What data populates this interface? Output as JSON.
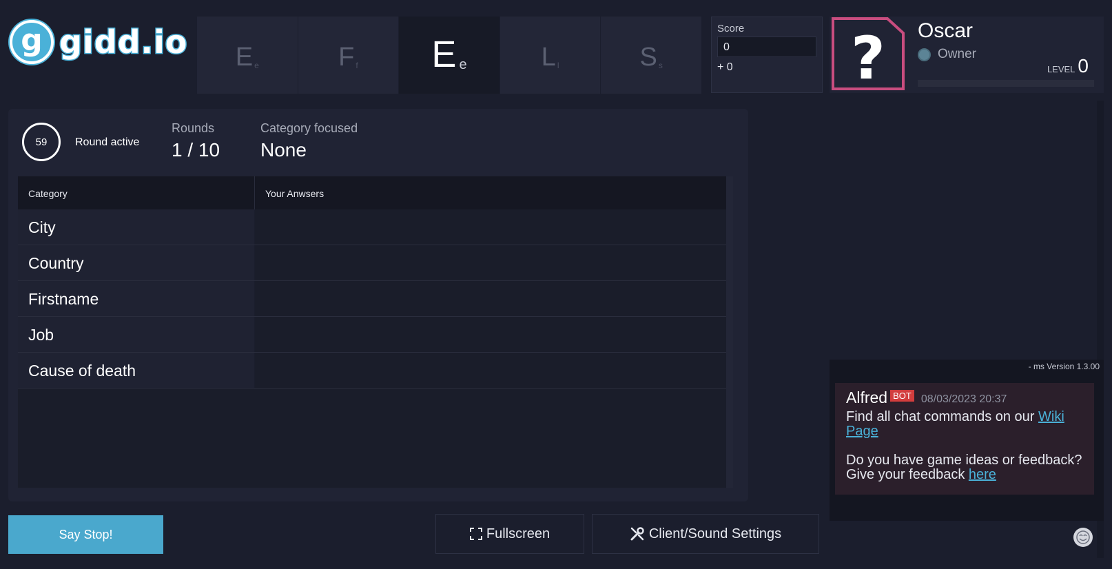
{
  "logo": {
    "mark": "g",
    "text": "gidd.io"
  },
  "letters": [
    {
      "big": "E",
      "small": "e",
      "active": false
    },
    {
      "big": "F",
      "small": "f",
      "active": false
    },
    {
      "big": "E",
      "small": "e",
      "active": true
    },
    {
      "big": "L",
      "small": "l",
      "active": false
    },
    {
      "big": "S",
      "small": "s",
      "active": false
    }
  ],
  "score": {
    "label": "Score",
    "value": "0",
    "plus": "+ 0"
  },
  "profile": {
    "name": "Oscar",
    "role": "Owner",
    "level_label": "LEVEL",
    "level_value": "0",
    "avatar_glyph": "?"
  },
  "round": {
    "timer": "59",
    "status": "Round active",
    "rounds_label": "Rounds",
    "rounds_value": "1 / 10",
    "category_label": "Category focused",
    "category_value": "None"
  },
  "table": {
    "headers": [
      "Category",
      "Your Anwsers"
    ],
    "rows": [
      "City",
      "Country",
      "Firstname",
      "Job",
      "Cause of death"
    ]
  },
  "buttons": {
    "stop": "Say Stop!",
    "fullscreen": "Fullscreen",
    "settings": "Client/Sound Settings"
  },
  "chat": {
    "version": "- ms Version 1.3.00",
    "author": "Alfred",
    "badge": "BOT",
    "time": "08/03/2023 20:37",
    "line1_pre": "Find all chat commands on our ",
    "line1_link": "Wiki Page",
    "line2_pre": "Do you have game ideas or feedback? Give your feedback ",
    "line2_link": "here"
  },
  "colors": {
    "background": "#1b1e2d",
    "accent": "#4aa8cd",
    "avatar_border": "#c94d7f",
    "bot_badge": "#d23d3d"
  }
}
